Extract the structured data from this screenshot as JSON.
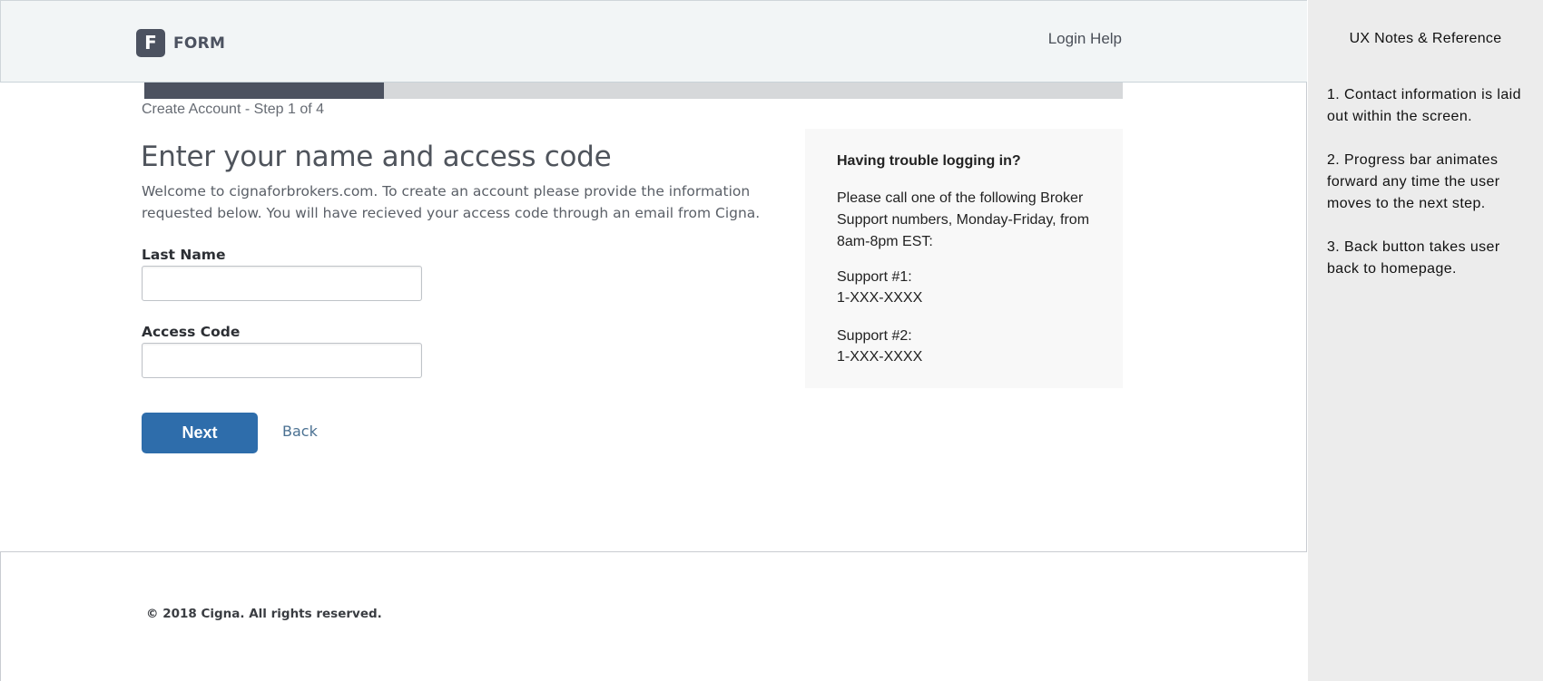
{
  "header": {
    "logo_letter": "F",
    "logo_text": "FORM",
    "login_help": "Login Help"
  },
  "progress": {
    "step_label": "Create Account - Step 1 of 4",
    "fraction": 0.245
  },
  "form": {
    "title": "Enter your name and access code",
    "intro": "Welcome to cignaforbrokers.com. To create an account please provide the information requested below. You will have recieved your access code through an email from Cigna.",
    "last_name_label": "Last Name",
    "last_name_value": "",
    "access_code_label": "Access Code",
    "access_code_value": "",
    "next_label": "Next",
    "back_label": "Back"
  },
  "help": {
    "title": "Having trouble logging in?",
    "body": "Please call one of the following Broker Support numbers, Monday-Friday, from 8am-8pm EST:",
    "support1_label": "Support #1:",
    "support1_number": "1-XXX-XXXX",
    "support2_label": "Support #2:",
    "support2_number": "1-XXX-XXXX"
  },
  "footer": {
    "copyright": "© 2018 Cigna. All rights reserved."
  },
  "notes": {
    "title": "UX Notes & Reference",
    "items": [
      "1. Contact information is laid out within the screen.",
      "2. Progress bar animates forward any time the user moves to the next step.",
      "3. Back button takes user back to homepage."
    ]
  },
  "colors": {
    "brand_dark": "#4c5260",
    "primary_button": "#2e6dab",
    "link": "#4b7192",
    "header_bg": "#f2f5f6",
    "panel_bg": "#f8f8f8",
    "notes_bg": "#ececec"
  }
}
